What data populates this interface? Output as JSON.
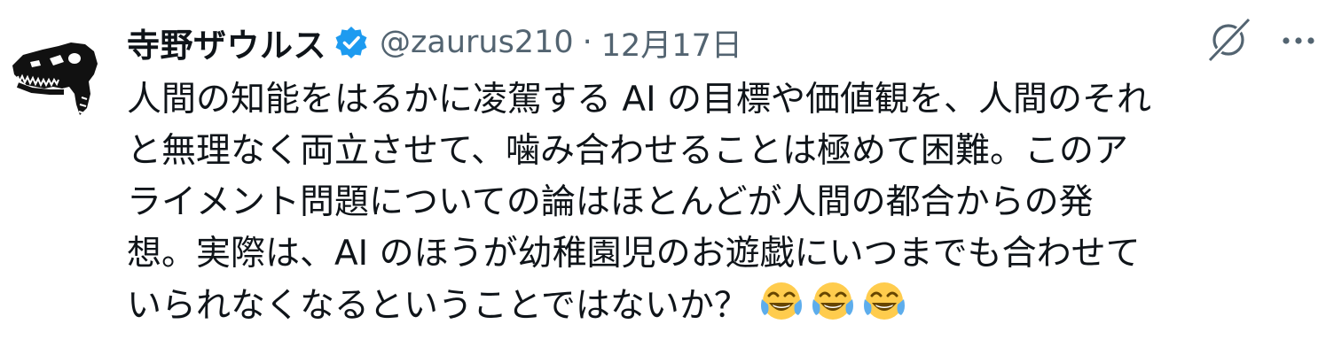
{
  "author": {
    "display_name": "寺野ザウルス",
    "handle": "@zaurus210",
    "separator": "·",
    "date": "12月17日",
    "verified": true,
    "verified_color": "#1d9bf0",
    "avatar_icon": "dinosaur-skull-icon"
  },
  "actions": {
    "grok_icon": "grok-icon",
    "more_icon": "more-icon"
  },
  "tweet": {
    "lines": [
      "人間の知能をはるかに凌駕する AI の目標や価値観を、人間のそれ",
      "と無理なく両立させて、噛み合わせることは極めて困難。このア",
      "ライメント問題についての論はほとんどが人間の都合からの発",
      "想。実際は、AI のほうが幼稚園児のお遊戯にいつまでも合わせて",
      "いられなくなるということではないか？"
    ],
    "trailing_emojis": [
      "face-with-tears-of-joy-emoji",
      "face-with-tears-of-joy-emoji",
      "face-with-tears-of-joy-emoji"
    ]
  },
  "colors": {
    "text": "#0f1419",
    "secondary": "#536471"
  }
}
